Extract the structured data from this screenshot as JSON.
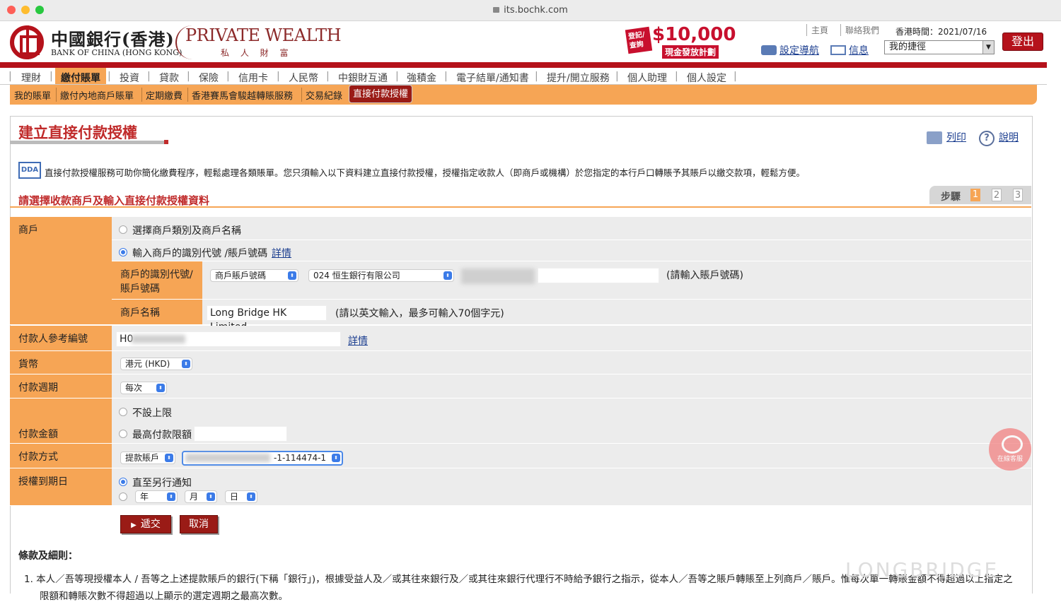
{
  "browser": {
    "url": "its.bochk.com"
  },
  "brand": {
    "bank_cn": "中國銀行(香港)",
    "bank_en": "BANK OF CHINA (HONG KONG)",
    "private_wealth_en": "PRIVATE WEALTH",
    "private_wealth_cn": "私 人 財 富",
    "promo_tag": "登記/查詢",
    "promo_amount": "$10,000",
    "promo_sub": "現金發放計劃"
  },
  "header": {
    "home": "主頁",
    "contact": "聯絡我們",
    "time": "香港時間：2021/07/16",
    "settings_nav": "設定導航",
    "messages": "信息",
    "quick_link": "我的捷徑",
    "logout": "登出"
  },
  "mainnav": [
    "理財",
    "繳付賬單",
    "投資",
    "貸款",
    "保險",
    "信用卡",
    "人民幣",
    "中銀財互通",
    "強積金",
    "電子結單/通知書",
    "提升/開立服務",
    "個人助理",
    "個人設定"
  ],
  "subnav": [
    "我的賬單",
    "繳付內地商戶賬單",
    "定期繳費",
    "香港賽馬會駿越轉賬服務",
    "交易紀錄",
    "直接付款授權"
  ],
  "page": {
    "title": "建立直接付款授權",
    "print": "列印",
    "help": "說明",
    "help_icon": "?",
    "dda_icon_label": "DDA",
    "intro": "直接付款授權服務可助你簡化繳費程序，輕鬆處理各類賬單。您只須輸入以下資料建立直接付款授權，授權指定收款人（即商戶或機構）於您指定的本行戶口轉賬予其賬戶以繳交款項，輕鬆方便。",
    "section": "請選擇收款商戶及輸入直接付款授權資料",
    "steps_label": "步驟",
    "steps": [
      "1",
      "2",
      "3"
    ]
  },
  "form": {
    "merchant_label": "商戶",
    "opt_category": "選擇商戶類別及商戶名稱",
    "opt_id": "輸入商戶的識別代號 /賬戶號碼",
    "details": "詳情",
    "merchant_id_label": "商戶的識別代號/賬戶號碼",
    "id_type": "商戶賬戶號碼",
    "bank": "024  恒生銀行有限公司",
    "account_hint": "(請輸入賬戶號碼)",
    "merchant_name_label": "商戶名稱",
    "merchant_name": "Long Bridge HK Limited",
    "merchant_name_hint": "(請以英文輸入，最多可輸入70個字元)",
    "payer_ref_label": "付款人參考編號",
    "payer_ref": "H0",
    "currency_label": "貨幣",
    "currency": "港元 (HKD)",
    "frequency_label": "付款週期",
    "frequency": "每次",
    "amount_label": "付款金額",
    "no_limit": "不設上限",
    "max_limit": "最高付款限額",
    "method_label": "付款方式",
    "method": "提款賬戶",
    "account_suffix": "-1-114474-1",
    "expiry_label": "授權到期日",
    "until_notice": "直至另行通知",
    "year": "年",
    "month": "月",
    "day": "日",
    "submit": "遞交",
    "cancel": "取消"
  },
  "terms": {
    "heading": "條款及細則：",
    "item1": "1.  本人／吾等現授權本人 / 吾等之上述提款賬戶的銀行(下稱「銀行」)，根據受益人及／或其往來銀行及／或其往來銀行代理行不時給予銀行之指示，從本人／吾等之賬戶轉賬至上列商戶／賬戶。惟每次單一轉賬金額不得超過以上指定之",
    "item1_cont": "限額和轉賬次數不得超過以上顯示的選定週期之最高次數。"
  },
  "chat": {
    "label": "在線客服"
  },
  "watermark": "LONGBRIDGE",
  "colors": {
    "brand_red": "#b5121b",
    "orange": "#f6a555",
    "link_blue": "#1a3d8f"
  }
}
